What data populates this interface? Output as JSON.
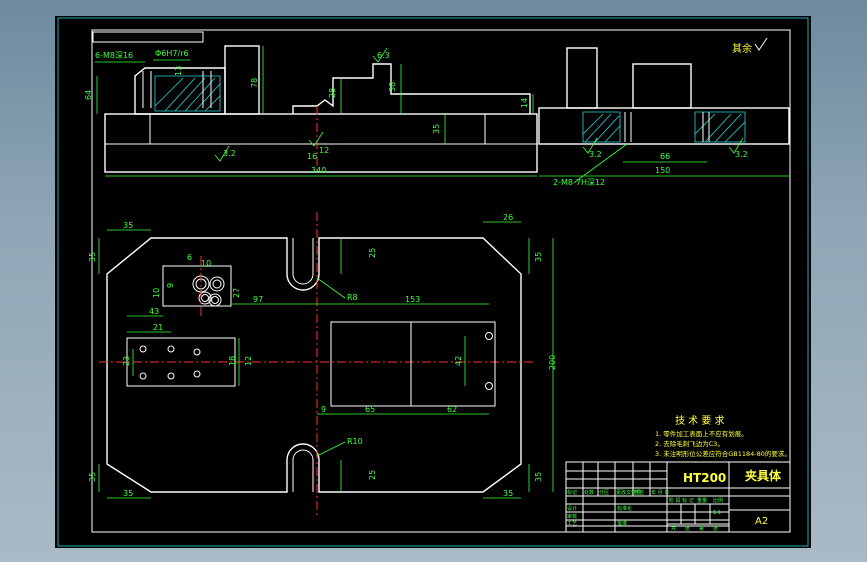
{
  "drawing": {
    "part_name": "夹具体",
    "material": "HT200",
    "sheet_size": "A2",
    "roughness_note": "其余",
    "roughness_value": "6.3"
  },
  "tech_requirements": {
    "title": "技 术 要 求",
    "items": [
      "1. 零件加工表面上不应有划痕。",
      "2. 去除毛刺飞边为C3。",
      "3. 未注明形位公差应符合GB1184-80的要求。"
    ]
  },
  "front_view": {
    "callouts": [
      "6-M8深16",
      "Φ6H7/r6"
    ],
    "dims": {
      "d64": "64",
      "d78": "78",
      "d13": "13",
      "d28": "28",
      "d38": "38",
      "d14": "14",
      "d35": "35",
      "d12": "12",
      "d16": "16",
      "d340": "340"
    },
    "roughness": [
      "6.3",
      "3.2",
      "3.2"
    ]
  },
  "side_view": {
    "callout": "2-M8-7H深12",
    "dims": {
      "d66": "66",
      "d150": "150"
    },
    "roughness": [
      "3.2",
      "3.2"
    ]
  },
  "plan_view": {
    "dims": {
      "c35_tl": "35",
      "c35_tl_v": "35",
      "c35_tr": "35",
      "c35_tr_v": "35",
      "c35_bl": "35",
      "c35_bl_v": "35",
      "c35_br": "35",
      "c35_br_v": "35",
      "d26": "26",
      "d25_top": "25",
      "d25_bot": "25",
      "d200": "200",
      "d97": "97",
      "d153": "153",
      "d42": "42",
      "d9": "9",
      "d65": "65",
      "d62": "62",
      "d6": "6",
      "d10": "10",
      "d27": "27",
      "d9b": "9",
      "d10b": "10",
      "d43": "43",
      "d21": "21",
      "d23": "23",
      "d18": "18",
      "d12": "12",
      "r8": "R8",
      "r10": "R10"
    }
  },
  "title_block": {
    "row_labels": [
      "标记",
      "处数",
      "分区",
      "更改文件号",
      "签名",
      "年 月 日"
    ],
    "design_labels": [
      "设计",
      "审核",
      "工艺"
    ],
    "std_labels": [
      "标准化",
      "批准"
    ],
    "stage_labels": [
      "阶 段 标 记",
      "重量",
      "比例"
    ],
    "scale": "1:1",
    "sheet_labels": [
      "共",
      "张",
      "第",
      "张"
    ]
  }
}
